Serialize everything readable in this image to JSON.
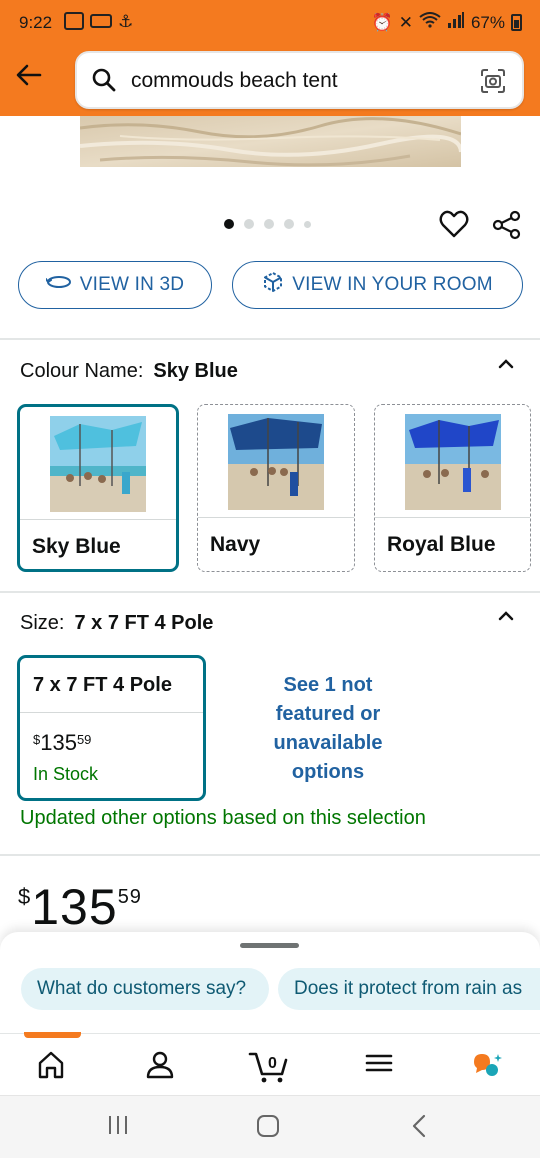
{
  "status_bar": {
    "time": "9:22",
    "battery": "67%"
  },
  "header": {
    "search_query": "commouds beach tent"
  },
  "gallery": {
    "page_count": 5,
    "active_index": 0
  },
  "actions": {
    "view_3d": "VIEW IN 3D",
    "view_room": "VIEW IN YOUR ROOM"
  },
  "colour": {
    "label": "Colour Name:",
    "selected": "Sky Blue",
    "options": [
      {
        "name": "Sky Blue",
        "swatch": "#4fc0de"
      },
      {
        "name": "Navy",
        "swatch": "#1d4a8c"
      },
      {
        "name": "Royal Blue",
        "swatch": "#2046c8"
      }
    ]
  },
  "size": {
    "label": "Size:",
    "selected": "7 x 7 FT 4 Pole",
    "option": {
      "name": "7 x 7 FT 4 Pole",
      "price_currency": "$",
      "price_whole": "135",
      "price_fraction": "59",
      "stock": "In Stock"
    },
    "see_more": "See 1 not featured or unavailable options",
    "updated_note": "Updated other options based on this selection"
  },
  "price": {
    "currency": "$",
    "whole": "135",
    "fraction": "59"
  },
  "assistant": {
    "chips": [
      "What do customers say?",
      "Does it protect from rain as"
    ]
  },
  "bottom_nav": {
    "cart_count": "0",
    "items": [
      "home-icon",
      "account-icon",
      "cart-icon",
      "menu-icon",
      "rufus-icon"
    ]
  },
  "colors": {
    "brand_orange": "#f47a1f",
    "link_blue": "#2162a1",
    "teal_selected": "#007185",
    "stock_green": "#007600"
  }
}
